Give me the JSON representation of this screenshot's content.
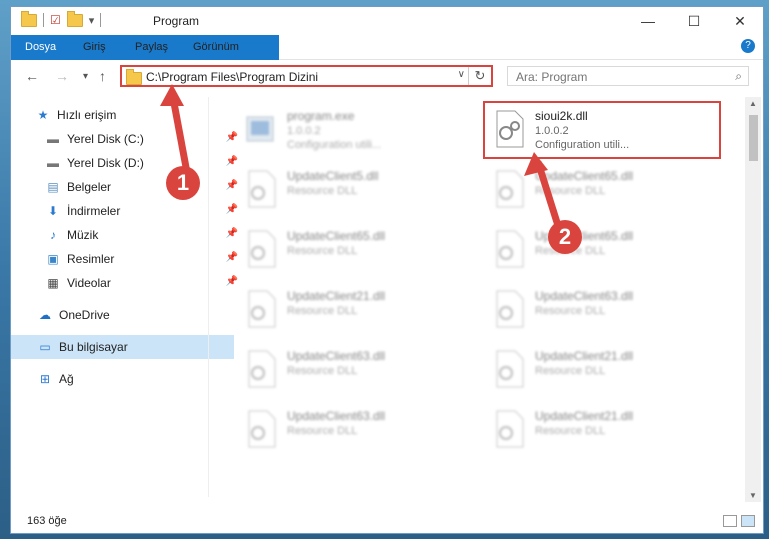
{
  "window": {
    "title": "Program",
    "controls": {
      "minimize": "—",
      "maximize": "☐",
      "close": "✕"
    }
  },
  "ribbon": {
    "tabs": [
      "Dosya",
      "Giriş",
      "Paylaş",
      "Görünüm"
    ],
    "help": "?"
  },
  "address": {
    "path": "C:\\Program Files\\Program Dizini",
    "search_placeholder": "Ara: Program"
  },
  "sidebar": {
    "items": [
      {
        "label": "Hızlı erişim",
        "icon": "star-icon"
      },
      {
        "label": "Yerel Disk (C:)",
        "icon": "drive-icon",
        "pinned": true
      },
      {
        "label": "Yerel Disk (D:)",
        "icon": "drive-icon",
        "pinned": true
      },
      {
        "label": "Belgeler",
        "icon": "documents-icon",
        "pinned": true
      },
      {
        "label": "İndirmeler",
        "icon": "download-icon",
        "pinned": true
      },
      {
        "label": "Müzik",
        "icon": "music-icon",
        "pinned": true
      },
      {
        "label": "Resimler",
        "icon": "pictures-icon",
        "pinned": true
      },
      {
        "label": "Videolar",
        "icon": "videos-icon",
        "pinned": true
      },
      {
        "label": "OneDrive",
        "icon": "cloud-icon"
      },
      {
        "label": "Bu bilgisayar",
        "icon": "computer-icon",
        "selected": true
      },
      {
        "label": "Ağ",
        "icon": "network-icon"
      }
    ]
  },
  "files": [
    {
      "name": "program.exe",
      "version": "1.0.0.2",
      "desc": "Configuration utili...",
      "blurred": true
    },
    {
      "name": "sioui2k.dll",
      "version": "1.0.0.2",
      "desc": "Configuration utili...",
      "blurred": false
    },
    {
      "name": "UpdateClient5.dll",
      "desc": "Resource DLL",
      "blurred": true
    },
    {
      "name": "UpdateClient65.dll",
      "desc": "Resource DLL",
      "blurred": true
    },
    {
      "name": "UpdateClient65.dll",
      "desc": "Resource DLL",
      "blurred": true
    },
    {
      "name": "UpdateClient65.dll",
      "desc": "Resource DLL",
      "blurred": true
    },
    {
      "name": "UpdateClient21.dll",
      "desc": "Resource DLL",
      "blurred": true
    },
    {
      "name": "UpdateClient63.dll",
      "desc": "Resource DLL",
      "blurred": true
    },
    {
      "name": "UpdateClient63.dll",
      "desc": "Resource DLL",
      "blurred": true
    },
    {
      "name": "UpdateClient21.dll",
      "desc": "Resource DLL",
      "blurred": true
    },
    {
      "name": "UpdateClient63.dll",
      "desc": "Resource DLL",
      "blurred": true
    },
    {
      "name": "UpdateClient21.dll",
      "desc": "Resource DLL",
      "blurred": true
    }
  ],
  "status": {
    "count": "163 öğe"
  },
  "annotations": {
    "badge1": "1",
    "badge2": "2",
    "color": "#d9453e"
  }
}
